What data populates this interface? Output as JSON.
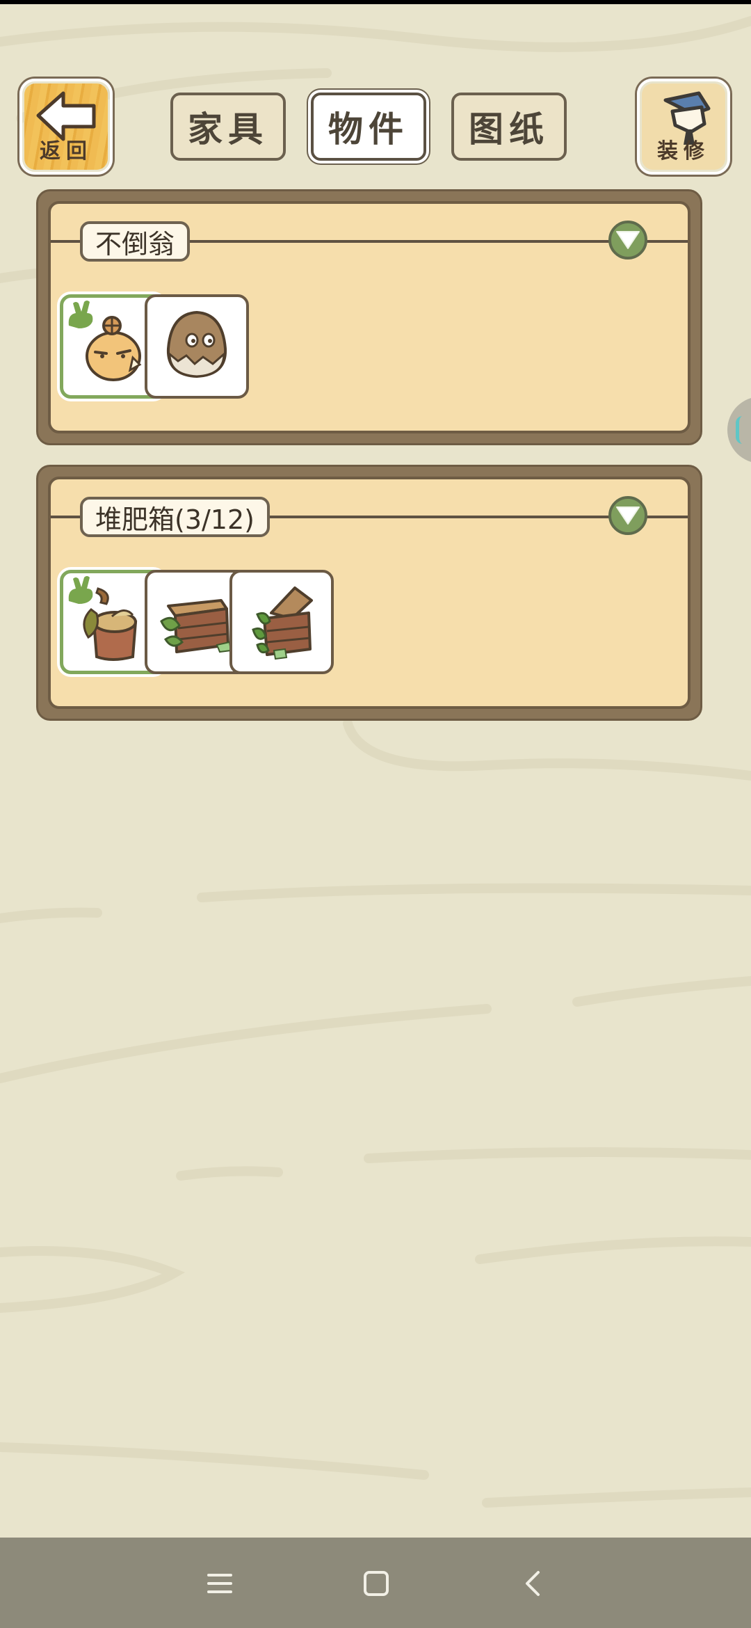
{
  "header": {
    "back_label": "返回",
    "renovate_label": "装修",
    "tabs": [
      {
        "label": "家具",
        "active": false
      },
      {
        "label": "物件",
        "active": true
      },
      {
        "label": "图纸",
        "active": false
      }
    ]
  },
  "groups": [
    {
      "title": "不倒翁",
      "items": [
        {
          "icon": "onion-tumbler-doll-icon",
          "selected": true
        },
        {
          "icon": "egg-tumbler-doll-icon",
          "selected": false
        }
      ]
    },
    {
      "title": "堆肥箱(3/12)",
      "items": [
        {
          "icon": "stump-compost-bin-icon",
          "selected": true
        },
        {
          "icon": "wooden-crate-compost-icon",
          "selected": false
        },
        {
          "icon": "open-chest-compost-icon",
          "selected": false
        }
      ]
    }
  ],
  "colors": {
    "background": "#e8e4cc",
    "panel_fill": "#f6deac",
    "panel_frame": "#8a7558",
    "selected_border": "#82a85c",
    "collapse_button": "#7f9e5d"
  },
  "system_nav": [
    "menu-icon",
    "home-icon",
    "back-icon"
  ]
}
